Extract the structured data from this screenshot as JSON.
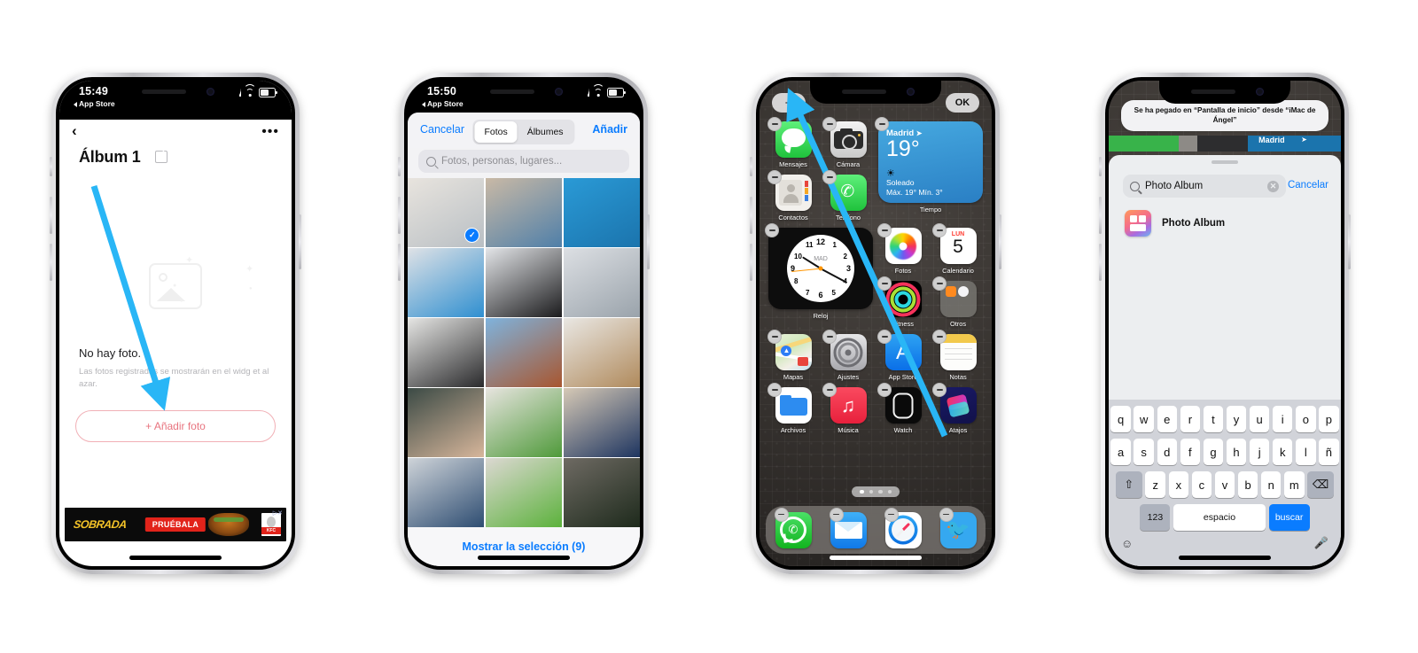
{
  "phone1": {
    "status": {
      "time": "15:49",
      "back_label": "App Store"
    },
    "nav": {
      "back_icon": "‹",
      "more_icon": "•••"
    },
    "title": "Álbum 1",
    "empty_title": "No hay foto.",
    "empty_sub": "Las fotos registradas se mostrarán en el widg et al azar.",
    "add_button": "+ Añadir foto",
    "ad": {
      "brand": "SOBRADA",
      "cta": "PRUÉBALA",
      "logo": "KFC"
    }
  },
  "phone2": {
    "status": {
      "time": "15:50",
      "back_label": "App Store"
    },
    "cancel": "Cancelar",
    "add": "Añadir",
    "segments": [
      {
        "label": "Fotos",
        "selected": true
      },
      {
        "label": "Álbumes",
        "selected": false
      }
    ],
    "search_placeholder": "Fotos, personas, lugares...",
    "footer": "Mostrar la selección (9)",
    "selected_count": 9,
    "photos": [
      {
        "name": "iphone-5c-box-accessories",
        "c1": "#e8e4de",
        "c2": "#b9bfc4",
        "selected": true
      },
      {
        "name": "hand-holding-blue-iphone",
        "c1": "#c9b9a6",
        "c2": "#4f7fa8",
        "selected": false
      },
      {
        "name": "blue-iphone-box",
        "c1": "#2a9ad6",
        "c2": "#1b74ad",
        "selected": false
      },
      {
        "name": "blue-iphone-back-on-box",
        "c1": "#dfe2e6",
        "c2": "#2f8fd0",
        "selected": false
      },
      {
        "name": "black-iphone-on-table",
        "c1": "#e3e5e8",
        "c2": "#1b1b1d",
        "selected": false
      },
      {
        "name": "sealed-iphone-package",
        "c1": "#dcdfe3",
        "c2": "#9aa3ab",
        "selected": false
      },
      {
        "name": "damaged-macbook-box",
        "c1": "#e6e6e4",
        "c2": "#2a2a2c",
        "selected": false
      },
      {
        "name": "brick-apartment-building",
        "c1": "#7fb3dd",
        "c2": "#a8562f",
        "selected": false
      },
      {
        "name": "white-wall-radiator",
        "c1": "#e9e7e3",
        "c2": "#b08a5c",
        "selected": false
      },
      {
        "name": "arm-on-dark-blanket",
        "c1": "#3b4a45",
        "c2": "#d7b69b",
        "selected": false
      },
      {
        "name": "potted-succulent-plant",
        "c1": "#e7e4df",
        "c2": "#4f9a3a",
        "selected": false
      },
      {
        "name": "navy-magsafe-case",
        "c1": "#d6c9b6",
        "c2": "#1e3560",
        "selected": false
      },
      {
        "name": "blue-phone-cases",
        "c1": "#cfd4d9",
        "c2": "#2e4d72",
        "selected": false
      },
      {
        "name": "green-plant-closeup",
        "c1": "#dcd8d2",
        "c2": "#5cb23c",
        "selected": false
      },
      {
        "name": "dark-plant-shadow",
        "c1": "#6e6a63",
        "c2": "#1e2a1c",
        "selected": false
      }
    ]
  },
  "phone3": {
    "add_widget_label": "+",
    "done_label": "OK",
    "apps_row1": [
      {
        "label": "Mensajes",
        "icon": "messages-icon"
      },
      {
        "label": "Cámara",
        "icon": "camera-icon"
      }
    ],
    "apps_row2": [
      {
        "label": "Contactos",
        "icon": "contacts-icon"
      },
      {
        "label": "Teléfono",
        "icon": "phone-icon"
      }
    ],
    "weather_widget": {
      "label": "Tiempo",
      "city": "Madrid",
      "temp": "19°",
      "condition": "Soleado",
      "range": "Máx. 19° Mín. 3°"
    },
    "clock_widget": {
      "label": "Reloj",
      "city": "MAD",
      "numerals": [
        "12",
        "1",
        "2",
        "3",
        "4",
        "5",
        "6",
        "7",
        "8",
        "9",
        "10",
        "11"
      ]
    },
    "apps_row3": [
      {
        "label": "Fotos",
        "icon": "photos-icon"
      },
      {
        "label": "Calendario",
        "icon": "calendar-icon",
        "day_name": "LUN",
        "day_num": "5"
      }
    ],
    "apps_row4": [
      {
        "label": "Fitness",
        "icon": "fitness-icon"
      },
      {
        "label": "Otros",
        "icon": "folder-icon"
      }
    ],
    "apps_row5": [
      {
        "label": "Mapas",
        "icon": "maps-icon"
      },
      {
        "label": "Ajustes",
        "icon": "settings-icon"
      },
      {
        "label": "App Store",
        "icon": "appstore-icon"
      },
      {
        "label": "Notas",
        "icon": "notes-icon"
      }
    ],
    "apps_row6": [
      {
        "label": "Archivos",
        "icon": "files-icon"
      },
      {
        "label": "Música",
        "icon": "music-icon"
      },
      {
        "label": "Watch",
        "icon": "watch-icon"
      },
      {
        "label": "Atajos",
        "icon": "shortcuts-icon"
      }
    ],
    "dock": [
      {
        "label": "WhatsApp",
        "icon": "whatsapp-icon"
      },
      {
        "label": "Mail",
        "icon": "mail-icon"
      },
      {
        "label": "Safari",
        "icon": "safari-icon"
      },
      {
        "label": "Twitter",
        "icon": "twitter-icon"
      }
    ],
    "page_dots": {
      "count": 4,
      "active": 0
    }
  },
  "phone4": {
    "toast": "Se ha pegado en “Pantalla de inicio” desde “iMac de Ángel”",
    "search_value": "Photo Album",
    "cancel": "Cancelar",
    "result": {
      "name": "Photo Album",
      "icon": "photo-album-app-icon"
    },
    "strip_city": "Madrid",
    "keyboard": {
      "row1": [
        "q",
        "w",
        "e",
        "r",
        "t",
        "y",
        "u",
        "i",
        "o",
        "p"
      ],
      "row2": [
        "a",
        "s",
        "d",
        "f",
        "g",
        "h",
        "j",
        "k",
        "l",
        "ñ"
      ],
      "row3": [
        "z",
        "x",
        "c",
        "v",
        "b",
        "n",
        "m"
      ],
      "shift": "⇧",
      "backspace": "⌫",
      "numbers": "123",
      "space": "espacio",
      "go": "buscar",
      "emoji": "☺",
      "mic": "mic-icon"
    }
  },
  "annotations": {
    "arrow_color": "#29b6f6",
    "arrows": [
      {
        "name": "arrow-to-add-photo-button"
      },
      {
        "name": "arrow-to-add-widget-button"
      }
    ]
  }
}
